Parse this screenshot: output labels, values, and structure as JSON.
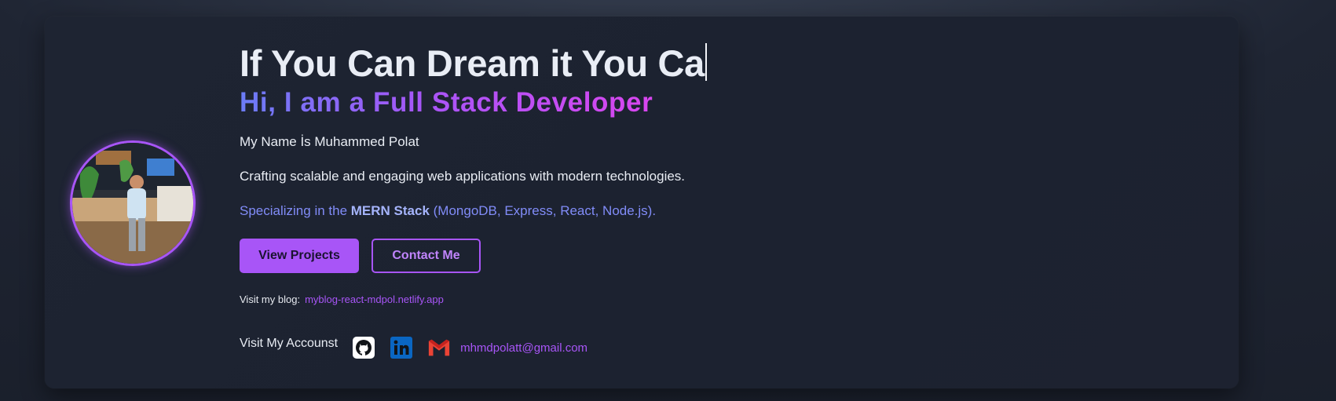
{
  "hero": {
    "headline": "If You Can Dream it You Ca",
    "subheadline": "Hi, I am a Full Stack Developer",
    "name_line": "My Name İs Muhammed Polat",
    "tagline": "Crafting scalable and engaging web applications with modern technologies.",
    "specialty_prefix": "Specializing in the ",
    "specialty_emphasis": "MERN Stack",
    "specialty_suffix": " (MongoDB, Express, React, Node.js)."
  },
  "buttons": {
    "primary_label": "View Projects",
    "secondary_label": "Contact Me"
  },
  "blog": {
    "label": "Visit my blog:",
    "link_text": "myblog-react-mdpol.netlify.app"
  },
  "accounts": {
    "label": "Visit My Accounst",
    "icons": [
      "github-icon",
      "linkedin-icon",
      "gmail-icon"
    ],
    "email": "mhmdpolatt@gmail.com"
  },
  "colors": {
    "accent": "#a855f7",
    "gradient_start": "#6b7cf6",
    "gradient_end": "#d946ef",
    "specialty": "#818cf8",
    "linkedin": "#0a66c2",
    "gmail": "#ea4335"
  }
}
